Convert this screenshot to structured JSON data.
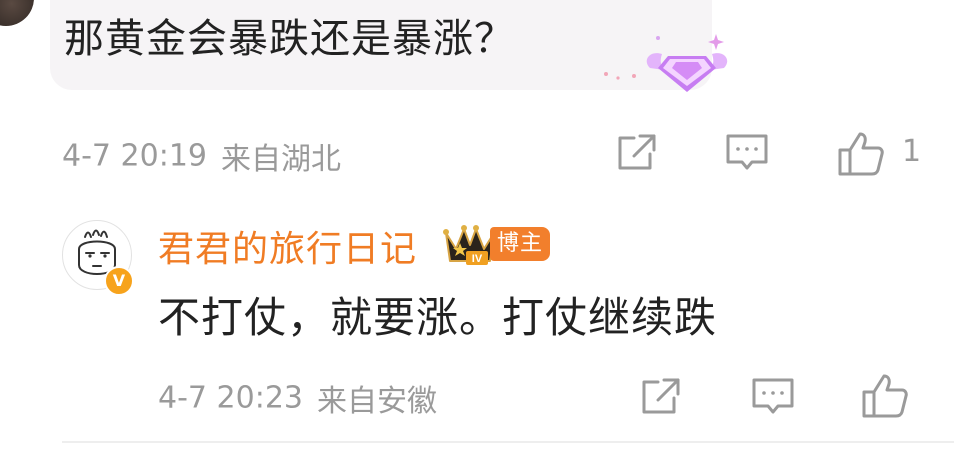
{
  "parent_comment": {
    "text": "那黄金会暴跌还是暴涨？",
    "time": "4-7 20:19",
    "location": "来自湖北",
    "like_count": "1",
    "icons": {
      "share": "share-icon",
      "comment": "comment-icon",
      "like": "thumbs-up-icon",
      "badge": "diamond-wings-badge-icon"
    }
  },
  "reply": {
    "username": "君君的旅行日记",
    "level_badge": "IV",
    "author_tag": "博主",
    "verified_mark": "V",
    "text": "不打仗，就要涨。打仗继续跌",
    "time": "4-7 20:23",
    "location": "来自安徽",
    "icons": {
      "share": "share-icon",
      "comment": "comment-icon",
      "like": "thumbs-up-icon"
    }
  },
  "colors": {
    "username": "#f07c24",
    "author_tag_bg": "#f27f2c",
    "meta_text": "#9a9a9a",
    "body_text": "#222222",
    "bubble_bg": "#f6f4f6"
  }
}
